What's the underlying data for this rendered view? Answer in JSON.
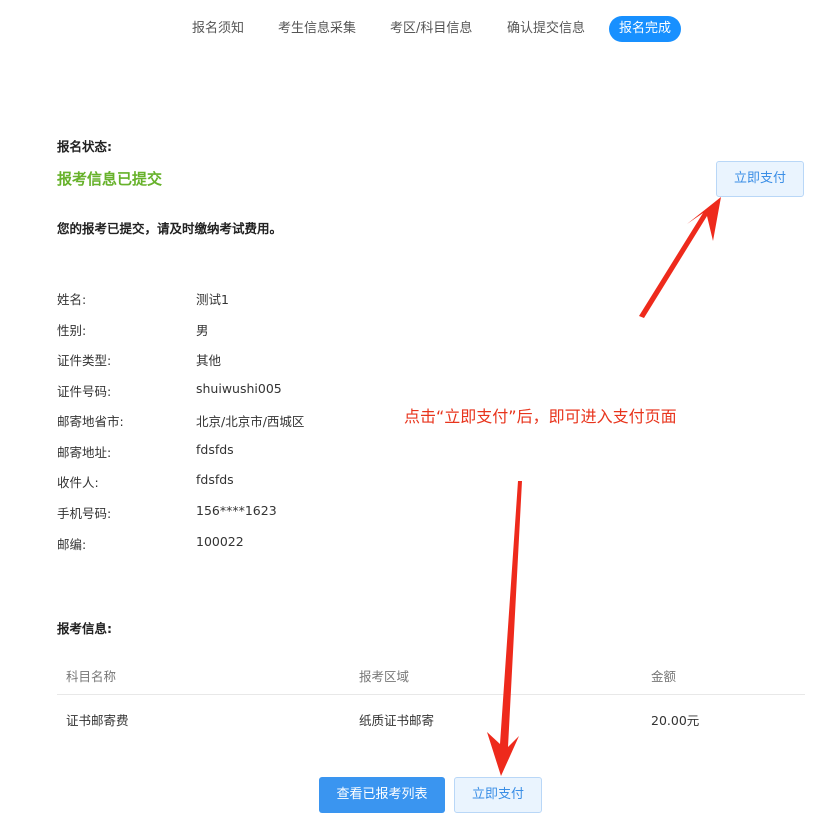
{
  "steps": [
    {
      "label": "报名须知"
    },
    {
      "label": "考生信息采集"
    },
    {
      "label": "考区/科目信息"
    },
    {
      "label": "确认提交信息"
    },
    {
      "label": "报名完成"
    }
  ],
  "status": {
    "heading": "报名状态:",
    "value": "报考信息已提交",
    "pay_button": "立即支付",
    "notice": "您的报考已提交，请及时缴纳考试费用。"
  },
  "info": [
    {
      "key": "姓名:",
      "value": "测试1"
    },
    {
      "key": "性别:",
      "value": "男"
    },
    {
      "key": "证件类型:",
      "value": "其他"
    },
    {
      "key": "证件号码:",
      "value": "shuiwushi005"
    },
    {
      "key": "邮寄地省市:",
      "value": "北京/北京市/西城区"
    },
    {
      "key": "邮寄地址:",
      "value": "fdsfds"
    },
    {
      "key": "收件人:",
      "value": "fdsfds"
    },
    {
      "key": "手机号码:",
      "value": "156****1623"
    },
    {
      "key": "邮编:",
      "value": "100022"
    }
  ],
  "annotation": "点击“立即支付”后，即可进入支付页面",
  "exam_info": {
    "heading": "报考信息:",
    "columns": [
      "科目名称",
      "报考区域",
      "金额"
    ],
    "rows": [
      [
        "证书邮寄费",
        "纸质证书邮寄",
        "20.00元"
      ]
    ]
  },
  "footer": {
    "view_list_button": "查看已报考列表",
    "pay_button": "立即支付"
  },
  "colors": {
    "accent": "#1890ff",
    "status_green": "#67b22b",
    "annotation_red": "#e8341c"
  }
}
